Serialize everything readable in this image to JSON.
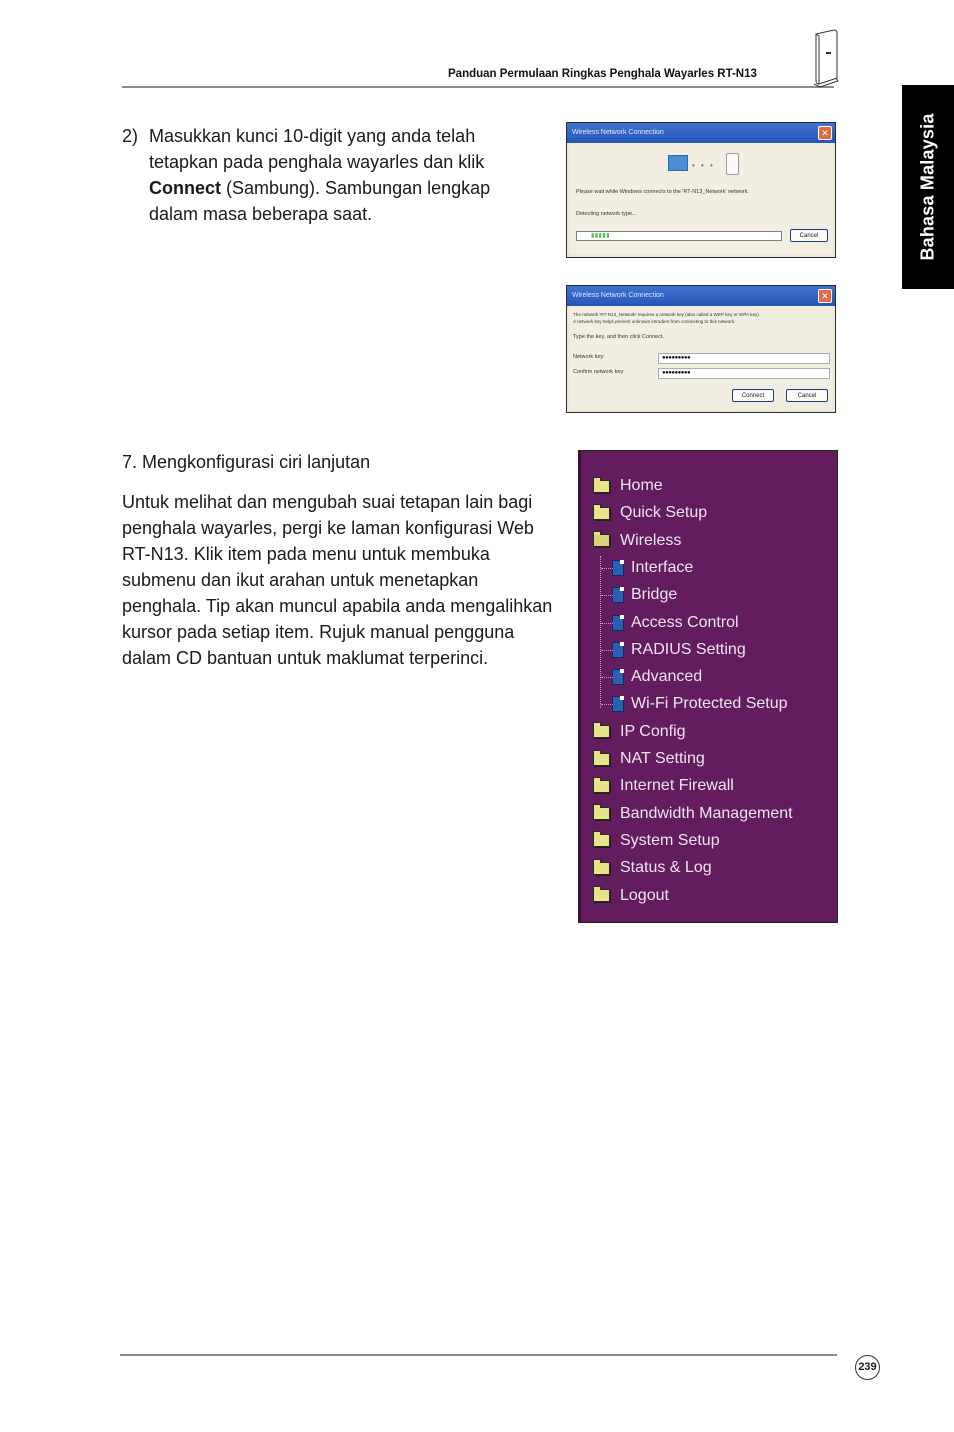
{
  "header": {
    "title": "Panduan Permulaan Ringkas Penghala Wayarles RT-N13"
  },
  "side_tab": {
    "label": "Bahasa Malaysia"
  },
  "step2": {
    "number": "2)",
    "line1": "Masukkan kunci 10-digit yang anda telah tetapkan pada penghala wayarles dan klik ",
    "bold": "Connect",
    "line2": " (Sambung). Sambungan lengkap dalam masa beberapa saat."
  },
  "dialog_connecting": {
    "title": "Wireless Network Connection",
    "message": "Please wait while Windows connects to the 'RT-N13_Network' network.",
    "status": "Detecting network type...",
    "progress_blocks": "▮▮▮▮▮",
    "cancel_label": "Cancel"
  },
  "dialog_key": {
    "title": "Wireless Network Connection",
    "message_line1": "The network 'RT-N13_Network' requires a network key (also called a WEP key or WPA key).",
    "message_line2": "A network key helps prevent unknown intruders from connecting to this network.",
    "instruction": "Type the key, and then click Connect.",
    "network_key_label": "Network key:",
    "network_key_value": "●●●●●●●●●",
    "confirm_key_label": "Confirm network key:",
    "confirm_key_value": "●●●●●●●●●",
    "connect_label": "Connect",
    "cancel_label": "Cancel"
  },
  "step7": {
    "heading": "7.  Mengkonfigurasi ciri lanjutan",
    "description": "Untuk melihat dan mengubah suai tetapan lain bagi penghala wayarles, pergi ke laman konfigurasi Web RT-N13. Klik item pada menu untuk membuka submenu dan ikut arahan untuk menetapkan penghala. Tip akan muncul apabila anda mengalihkan kursor pada setiap item. Rujuk manual pengguna dalam CD bantuan untuk maklumat terperinci."
  },
  "menu": {
    "items": [
      {
        "label": "Home",
        "icon": "folder-icon",
        "level": 0
      },
      {
        "label": "Quick Setup",
        "icon": "folder-icon",
        "level": 0
      },
      {
        "label": "Wireless",
        "icon": "folder-open-icon",
        "level": 0
      },
      {
        "label": "Interface",
        "icon": "document-icon",
        "level": 1
      },
      {
        "label": "Bridge",
        "icon": "document-icon",
        "level": 1
      },
      {
        "label": "Access Control",
        "icon": "document-icon",
        "level": 1
      },
      {
        "label": "RADIUS Setting",
        "icon": "document-icon",
        "level": 1
      },
      {
        "label": "Advanced",
        "icon": "document-icon",
        "level": 1
      },
      {
        "label": "Wi-Fi Protected Setup",
        "icon": "document-icon",
        "level": 1
      },
      {
        "label": "IP Config",
        "icon": "folder-icon",
        "level": 0
      },
      {
        "label": "NAT Setting",
        "icon": "folder-icon",
        "level": 0
      },
      {
        "label": "Internet Firewall",
        "icon": "folder-icon",
        "level": 0
      },
      {
        "label": "Bandwidth Management",
        "icon": "folder-icon",
        "level": 0
      },
      {
        "label": "System Setup",
        "icon": "folder-icon",
        "level": 0
      },
      {
        "label": "Status & Log",
        "icon": "folder-icon",
        "level": 0
      },
      {
        "label": "Logout",
        "icon": "folder-icon",
        "level": 0
      }
    ]
  },
  "footer": {
    "page_number": "239"
  },
  "colors": {
    "menu_background": "#631d5e",
    "menu_text": "#f0e6ee",
    "folder": "#e7e48c",
    "doc_icon": "#2c5fb3",
    "side_tab": "#000000",
    "dialog_title": "#2456b8"
  }
}
